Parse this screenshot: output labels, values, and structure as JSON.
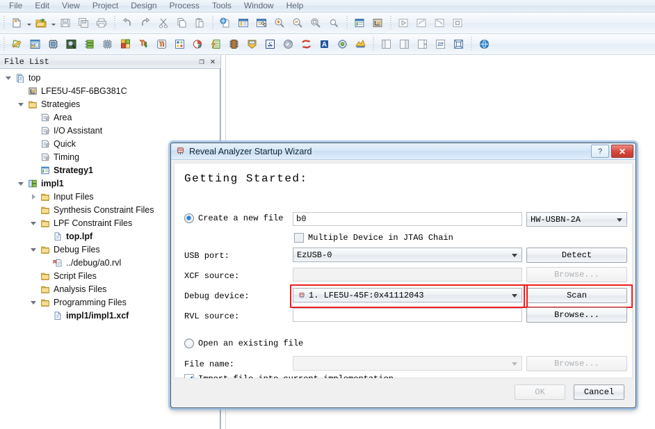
{
  "menu": {
    "items": [
      {
        "label": "File"
      },
      {
        "label": "Edit"
      },
      {
        "label": "View"
      },
      {
        "label": "Project"
      },
      {
        "label": "Design"
      },
      {
        "label": "Process"
      },
      {
        "label": "Tools"
      },
      {
        "label": "Window"
      },
      {
        "label": "Help"
      }
    ]
  },
  "toolbar_row1": [
    {
      "name": "new-file-icon"
    },
    {
      "name": "new-file-dropdown-caret"
    },
    {
      "name": "open-file-icon"
    },
    {
      "name": "open-file-dropdown-caret"
    },
    {
      "name": "save-icon"
    },
    {
      "name": "save-all-icon"
    },
    {
      "name": "print-icon"
    },
    {
      "name": "separator"
    },
    {
      "name": "undo-icon"
    },
    {
      "name": "redo-icon"
    },
    {
      "name": "cut-icon"
    },
    {
      "name": "copy-icon"
    },
    {
      "name": "paste-icon"
    },
    {
      "name": "separator"
    },
    {
      "name": "find-in-file-icon"
    },
    {
      "name": "report-icon"
    },
    {
      "name": "find-replace-icon"
    },
    {
      "name": "zoom-in-icon"
    },
    {
      "name": "zoom-out-icon"
    },
    {
      "name": "zoom-fit-icon"
    },
    {
      "name": "zoom-select-icon"
    },
    {
      "name": "separator"
    },
    {
      "name": "strategy-icon"
    },
    {
      "name": "device-icon"
    },
    {
      "name": "separator"
    },
    {
      "name": "run-icon"
    },
    {
      "name": "run-step-icon"
    },
    {
      "name": "rerun-icon"
    },
    {
      "name": "stop-icon"
    }
  ],
  "toolbar_row2": [
    {
      "name": "edit-design-icon"
    },
    {
      "name": "spreadsheet-view-icon"
    },
    {
      "name": "device-chip-icon"
    },
    {
      "name": "package-view-icon"
    },
    {
      "name": "netlist-view-icon"
    },
    {
      "name": "floorplan-chip-icon"
    },
    {
      "name": "floorplan-view-icon"
    },
    {
      "name": "physical-view-in-icon"
    },
    {
      "name": "physical-view-out-icon"
    },
    {
      "name": "timing-analysis-icon"
    },
    {
      "name": "gridview-icon"
    },
    {
      "name": "power-calculator-icon"
    },
    {
      "name": "eco-editor-icon"
    },
    {
      "name": "programmer-icon"
    },
    {
      "name": "reveal-inserter-icon"
    },
    {
      "name": "reveal-analyzer-icon"
    },
    {
      "name": "simulation-wizard-icon"
    },
    {
      "name": "synplify-icon"
    },
    {
      "name": "active-hdl-icon"
    },
    {
      "name": "ipexpress-icon"
    },
    {
      "name": "clarity-designer-icon"
    },
    {
      "name": "separator"
    },
    {
      "name": "dock-left-icon"
    },
    {
      "name": "dock-right-icon"
    },
    {
      "name": "dock-bottom-icon"
    },
    {
      "name": "swap-panes-icon"
    },
    {
      "name": "restore-layout-icon"
    },
    {
      "name": "separator"
    },
    {
      "name": "web-browser-icon"
    }
  ],
  "file_list": {
    "title": "File List",
    "float_button": "❐",
    "close_button": "✕",
    "tree": [
      {
        "label": "top",
        "indent": 0,
        "twisty": "open",
        "icon": "project-icon",
        "bold": false
      },
      {
        "label": "LFE5U-45F-6BG381C",
        "indent": 1,
        "twisty": "none",
        "icon": "device-icon",
        "bold": false
      },
      {
        "label": "Strategies",
        "indent": 1,
        "twisty": "open",
        "icon": "folder-icon",
        "bold": false
      },
      {
        "label": "Area",
        "indent": 2,
        "twisty": "none",
        "icon": "strategy-icon",
        "bold": false
      },
      {
        "label": "I/O Assistant",
        "indent": 2,
        "twisty": "none",
        "icon": "strategy-icon",
        "bold": false
      },
      {
        "label": "Quick",
        "indent": 2,
        "twisty": "none",
        "icon": "strategy-icon",
        "bold": false
      },
      {
        "label": "Timing",
        "indent": 2,
        "twisty": "none",
        "icon": "strategy-icon",
        "bold": false
      },
      {
        "label": "Strategy1",
        "indent": 2,
        "twisty": "none",
        "icon": "strategy-active-icon",
        "bold": true
      },
      {
        "label": "impl1",
        "indent": 1,
        "twisty": "open",
        "icon": "impl-icon",
        "bold": true
      },
      {
        "label": "Input Files",
        "indent": 2,
        "twisty": "closed",
        "icon": "folder-icon",
        "bold": false
      },
      {
        "label": "Synthesis Constraint Files",
        "indent": 2,
        "twisty": "none",
        "icon": "folder-icon",
        "bold": false
      },
      {
        "label": "LPF Constraint Files",
        "indent": 2,
        "twisty": "open",
        "icon": "folder-icon",
        "bold": false
      },
      {
        "label": "top.lpf",
        "indent": 3,
        "twisty": "none",
        "icon": "file-icon",
        "bold": true
      },
      {
        "label": "Debug Files",
        "indent": 2,
        "twisty": "open",
        "icon": "folder-icon",
        "bold": false
      },
      {
        "label": "../debug/a0.rvl",
        "indent": 3,
        "twisty": "none",
        "icon": "rvl-file-icon",
        "bold": false
      },
      {
        "label": "Script Files",
        "indent": 2,
        "twisty": "none",
        "icon": "folder-icon",
        "bold": false
      },
      {
        "label": "Analysis Files",
        "indent": 2,
        "twisty": "none",
        "icon": "folder-icon",
        "bold": false
      },
      {
        "label": "Programming Files",
        "indent": 2,
        "twisty": "open",
        "icon": "folder-icon",
        "bold": false
      },
      {
        "label": "impl1/impl1.xcf",
        "indent": 3,
        "twisty": "none",
        "icon": "file-icon",
        "bold": true
      }
    ]
  },
  "dialog": {
    "title": "Reveal Analyzer Startup Wizard",
    "title_icon": "reveal-analyzer-icon",
    "help_button": "?",
    "close_button": "✕",
    "heading": "Getting Started:",
    "create_new_file": {
      "radio_label": "Create a new file",
      "selected": true,
      "filename_value": "b0",
      "cable_value": "HW-USBN-2A"
    },
    "multiple_device": {
      "label": "Multiple Device in JTAG Chain",
      "checked": false
    },
    "usb_port": {
      "label": "USB port:",
      "value": "EzUSB-0",
      "button": "Detect"
    },
    "xcf_source": {
      "label": "XCF source:",
      "value": "",
      "button": "Browse..."
    },
    "debug_device": {
      "label": "Debug device:",
      "value": "1.  LFE5U-45F:0x41112043",
      "icon": "device-chip-icon",
      "button": "Scan",
      "highlight_color": "#ee1d1d"
    },
    "rvl_source": {
      "label": "RVL source:",
      "value": "",
      "button": "Browse..."
    },
    "open_existing_file": {
      "radio_label": "Open an existing file",
      "selected": false
    },
    "file_name": {
      "label": "File name:",
      "value": "",
      "button": "Browse..."
    },
    "import_file": {
      "label": "Import file into current implementation",
      "checked": true
    },
    "ok_button": {
      "label": "OK",
      "enabled": false
    },
    "cancel_button": {
      "label": "Cancel",
      "enabled": true
    }
  }
}
